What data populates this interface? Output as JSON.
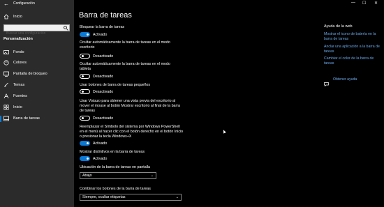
{
  "window": {
    "title": "Configuración",
    "back_glyph": "←",
    "minimize_glyph": "—",
    "maximize_glyph": "☐",
    "close_glyph": "✕"
  },
  "sidebar": {
    "home_label": "Inicio",
    "search_placeholder": "Buscar una configuración",
    "section_label": "Personalización",
    "items": [
      {
        "label": "Fondo",
        "icon": "picture-icon"
      },
      {
        "label": "Colores",
        "icon": "palette-icon"
      },
      {
        "label": "Pantalla de bloqueo",
        "icon": "lock-screen-icon"
      },
      {
        "label": "Temas",
        "icon": "brush-icon"
      },
      {
        "label": "Fuentes",
        "icon": "font-icon"
      },
      {
        "label": "Inicio",
        "icon": "start-icon"
      },
      {
        "label": "Barra de tareas",
        "icon": "taskbar-icon",
        "selected": true
      }
    ]
  },
  "main": {
    "title": "Barra de tareas",
    "options": [
      {
        "label": "Bloquear la barra de tareas",
        "state": "on",
        "state_label": "Activado"
      },
      {
        "label": "Ocultar automáticamente la barra de tareas en el modo escritorio",
        "state": "off",
        "state_label": "Desactivado"
      },
      {
        "label": "Ocultar automáticamente la barra de tareas en el modo tableta",
        "state": "off",
        "state_label": "Desactivado"
      },
      {
        "label": "Usar botones de barra de tareas pequeños",
        "state": "off",
        "state_label": "Desactivado"
      },
      {
        "label": "Usar Vistazo para obtener una vista previa del escritorio al mover el mouse al botón Mostrar escritorio al final de la barra de tareas",
        "state": "off",
        "state_label": "Desactivado"
      },
      {
        "label": "Reemplazar el Símbolo del sistema por Windows PowerShell en el menú al hacer clic con el botón derecho en el botón Inicio o presionar la tecla Windows+X",
        "state": "on",
        "state_label": "Activado"
      },
      {
        "label": "Mostrar distintivos en la barra de tareas",
        "state": "on",
        "state_label": "Activado"
      }
    ],
    "location_label": "Ubicación de la barra de tareas en pantalla",
    "location_value": "Abajo",
    "combine_label": "Combinar los botones de la barra de tareas",
    "combine_value": "Siempre, ocultar etiquetas"
  },
  "help": {
    "title": "Ayuda de la web",
    "links": [
      "Mostrar el icono de batería en la barra de tareas",
      "Anclar una aplicación a la barra de tareas",
      "Cambiar el color de la barra de tareas"
    ],
    "get_help": "Obtener ayuda"
  },
  "colors": {
    "accent": "#0a78d4",
    "sidebar_bg": "#2b2b2b",
    "link": "#6aa9e9"
  }
}
